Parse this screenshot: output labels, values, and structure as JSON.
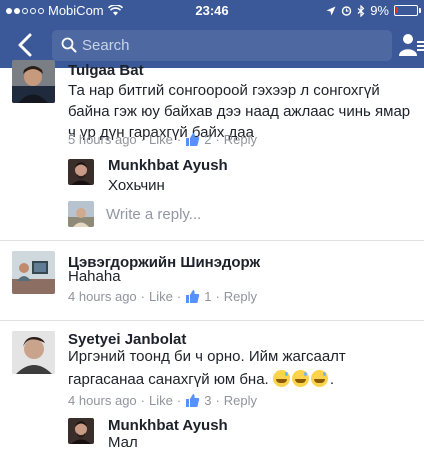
{
  "status_bar": {
    "carrier": "MobiCom",
    "time": "23:46",
    "battery": "9%",
    "battery_level": 0.09,
    "icons": [
      "wifi-icon",
      "location-arrow-icon",
      "alarm-icon",
      "bluetooth-icon",
      "battery-icon"
    ]
  },
  "nav": {
    "back_icon": "chevron-left-icon",
    "search_placeholder": "Search",
    "friends_icon": "friend-requests-icon",
    "bar_color": "#3b5998"
  },
  "comments": [
    {
      "name": "Tulgaa Bat",
      "text": "Та нар битгий сонгоороой гэхээр л сонгохгүй байна гэж юу байхав дээ наад ажлаас чинь ямар ч үр дүн гарахгүй байх даа",
      "time": "5 hours ago",
      "like_label": "Like",
      "likes": "2",
      "reply_label": "Reply",
      "replies": [
        {
          "name": "Munkhbat Ayush",
          "text": "Хохьчин"
        }
      ],
      "reply_placeholder": "Write a reply..."
    },
    {
      "name": "Цэвэгдоржийн Шинэдорж",
      "text": "Hahaha",
      "time": "4 hours ago",
      "like_label": "Like",
      "likes": "1",
      "reply_label": "Reply"
    },
    {
      "name": "Syetyei Janbolat",
      "text_line1": "Иргэний тоонд би ч орно. Ийм жагсаалт",
      "text_line2": "гаргасанаа санахгүй юм бна.",
      "text_end": ".",
      "time": "4 hours ago",
      "like_label": "Like",
      "likes": "3",
      "reply_label": "Reply",
      "replies": [
        {
          "name": "Munkhbat Ayush",
          "text": "Мал"
        }
      ]
    }
  ],
  "separator": " · ",
  "colors": {
    "link_blue": "#3b5998",
    "meta_gray": "#90949c",
    "like_blue": "#5890ff"
  }
}
